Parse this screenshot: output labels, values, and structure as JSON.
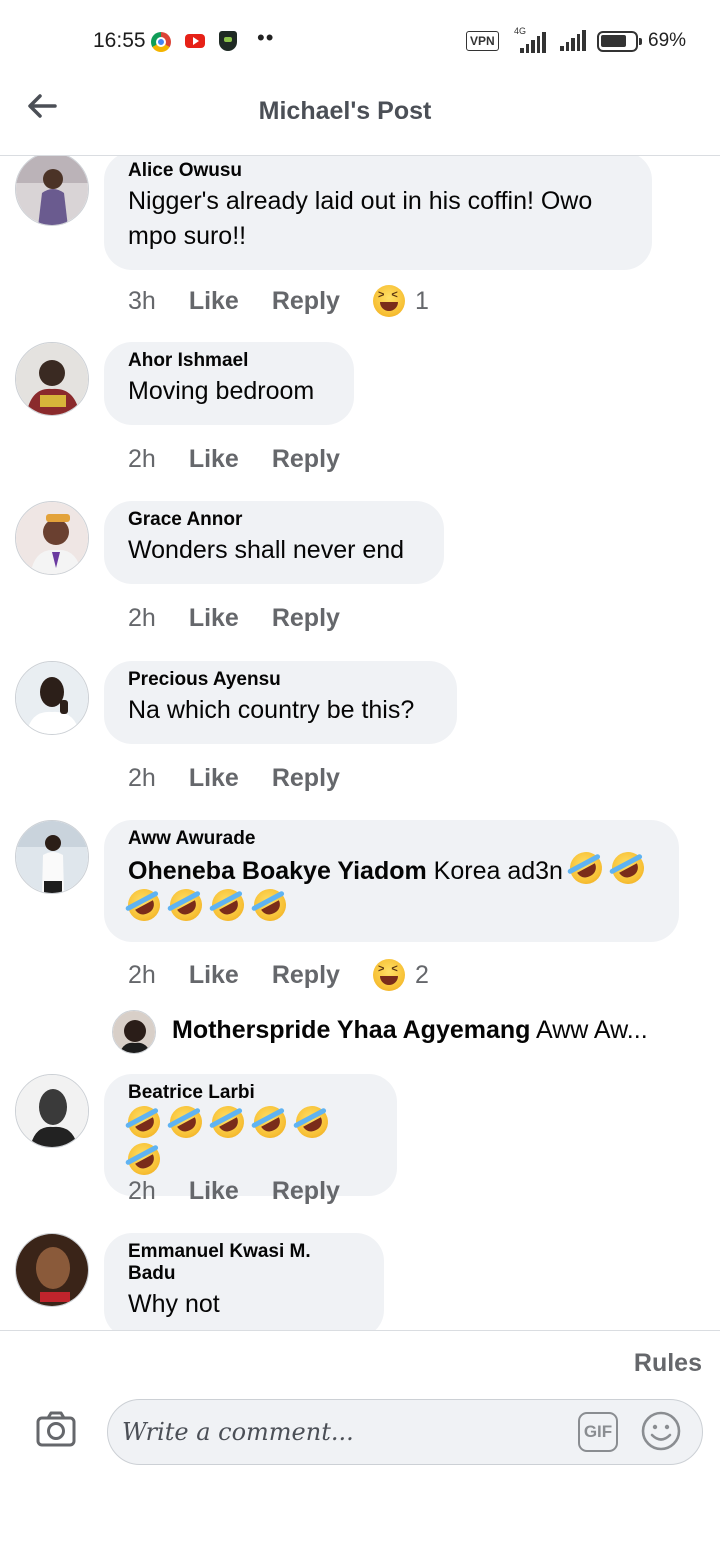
{
  "status_bar": {
    "time": "16:55",
    "vpn": "VPN",
    "network": "4G",
    "battery": "69%",
    "battery_level_percent": 69,
    "app_icons": [
      "chrome-icon",
      "youtube-icon",
      "shield-app-icon"
    ]
  },
  "header": {
    "title": "Michael's Post"
  },
  "comments": [
    {
      "name": "Alice Owusu",
      "text": "Nigger's already laid out in his coffin! Owo mpo suro!!",
      "time": "3h",
      "like": "Like",
      "reply": "Reply",
      "reaction_count": "1"
    },
    {
      "name": "Ahor Ishmael",
      "text": "Moving bedroom",
      "time": "2h",
      "like": "Like",
      "reply": "Reply"
    },
    {
      "name": "Grace Annor",
      "text": "Wonders shall never end",
      "time": "2h",
      "like": "Like",
      "reply": "Reply"
    },
    {
      "name": "Precious Ayensu",
      "text": "Na which country be this?",
      "time": "2h",
      "like": "Like",
      "reply": "Reply"
    },
    {
      "name": "Aww Awurade",
      "mention": "Oheneba Boakye Yiadom",
      "text": "Korea ad3n",
      "emoji_count": 6,
      "time": "2h",
      "like": "Like",
      "reply": "Reply",
      "reaction_count": "2"
    },
    {
      "name": "Beatrice Larbi",
      "emoji_count": 6,
      "time": "2h",
      "like": "Like",
      "reply": "Reply"
    },
    {
      "name": "Emmanuel Kwasi M. Badu",
      "text": "Why not"
    }
  ],
  "reply_preview": {
    "name": "Motherspride Yhaa Agyemang",
    "text": "Aww Aw..."
  },
  "composer": {
    "rules": "Rules",
    "placeholder": "Write a comment...",
    "gif": "GIF"
  },
  "colors": {
    "bubble": "#f0f2f5",
    "secondary_text": "#65676b",
    "header_text": "#4b4f56"
  }
}
